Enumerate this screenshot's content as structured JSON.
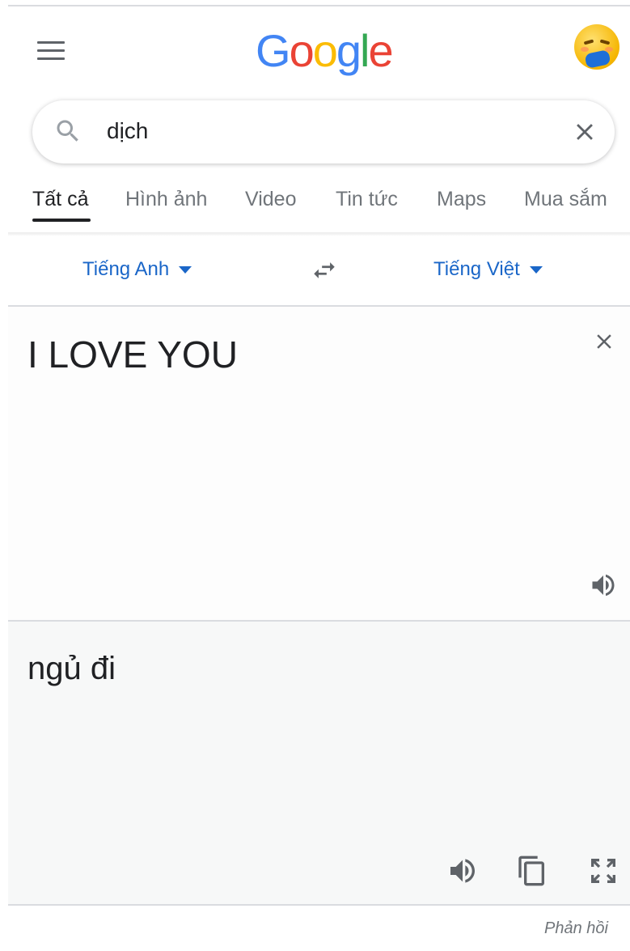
{
  "logo": {
    "letters": [
      "G",
      "o",
      "o",
      "g",
      "l",
      "e"
    ]
  },
  "search": {
    "query": "dịch"
  },
  "tabs": [
    {
      "label": "Tất cả",
      "active": true
    },
    {
      "label": "Hình ảnh"
    },
    {
      "label": "Video"
    },
    {
      "label": "Tin tức"
    },
    {
      "label": "Maps"
    },
    {
      "label": "Mua sắm"
    }
  ],
  "translate": {
    "source_lang": "Tiếng Anh",
    "target_lang": "Tiếng Việt",
    "source_text": "I LOVE YOU",
    "target_text": "ngủ đi"
  },
  "footer": {
    "feedback_label": "Phản hồi"
  },
  "colors": {
    "link_blue": "#1a66c8",
    "icon_gray": "#5f6368",
    "panel_bg": "#f7f8f8"
  },
  "icons": [
    "menu-icon",
    "search-icon",
    "close-icon",
    "caret-down-icon",
    "swap-icon",
    "speaker-icon",
    "copy-icon",
    "fullscreen-icon"
  ]
}
